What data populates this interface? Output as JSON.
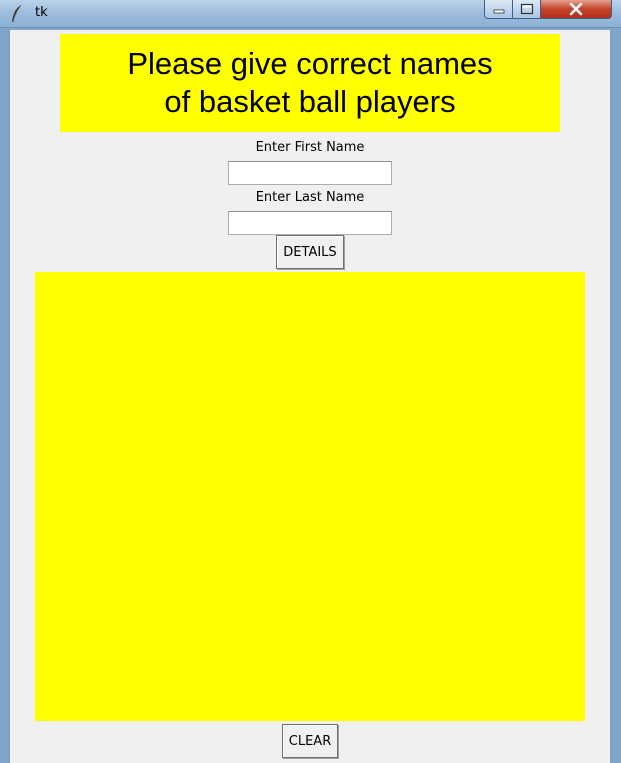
{
  "window": {
    "title": "tk",
    "buttons": {
      "minimize": "minimize",
      "maximize": "maximize",
      "close": "close"
    }
  },
  "heading": {
    "line1": "Please give correct names",
    "line2": "of basket ball players",
    "background": "#ffff00"
  },
  "form": {
    "first_name": {
      "label": "Enter First Name",
      "value": ""
    },
    "last_name": {
      "label": "Enter Last Name",
      "value": ""
    },
    "details_button": "DETAILS"
  },
  "output_panel": {
    "background": "#ffff00"
  },
  "clear_button": "CLEAR"
}
